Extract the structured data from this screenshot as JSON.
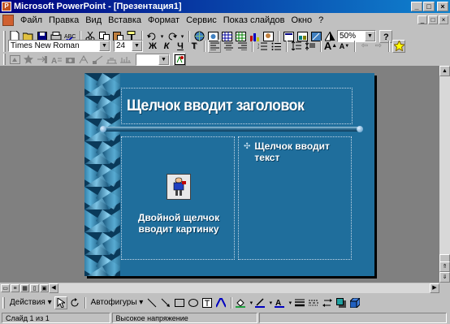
{
  "window": {
    "title": "Microsoft PowerPoint - [Презентация1]",
    "controls": [
      "_",
      "□",
      "×"
    ]
  },
  "menu": {
    "items": [
      "Файл",
      "Правка",
      "Вид",
      "Вставка",
      "Формат",
      "Сервис",
      "Показ слайдов",
      "Окно",
      "?"
    ],
    "doc_controls": [
      "_",
      "□",
      "×"
    ]
  },
  "toolbar_standard": {
    "zoom": "50%",
    "icons": [
      "new-icon",
      "open-icon",
      "save-icon",
      "print-icon",
      "spelling-icon",
      "cut-icon",
      "copy-icon",
      "paste-icon",
      "format-painter-icon",
      "undo-icon",
      "redo-icon",
      "hyperlink-icon",
      "web-toolbar-icon",
      "insert-word-table-icon",
      "insert-excel-icon",
      "insert-chart-icon",
      "new-slide-icon",
      "slide-layout-icon",
      "apply-design-icon",
      "grayscale-icon",
      "help-icon"
    ]
  },
  "toolbar_formatting": {
    "font": "Times New Roman",
    "size": "24",
    "bold": "Ж",
    "italic": "К",
    "underline": "Ч",
    "shadow": "Т"
  },
  "toolbar_effects": {
    "icons": [
      "animation-effects-icon",
      "star-icon",
      "animation-preview-icon",
      "custom-animation-icon",
      "action-settings-icon",
      "slide-transition-icon",
      "hide-slide-icon",
      "rehearse-timings-icon",
      "summary-slide-icon",
      "speaker-notes-icon",
      "effects-icon"
    ]
  },
  "slide": {
    "title": "Щелчок вводит заголовок",
    "clipart_caption": "Двойной щелчок вводит картинку",
    "bullet_text": "Щелчок вводит текст"
  },
  "drawing_toolbar": {
    "actions_label": "Действия",
    "autoshapes_label": "Автофигуры"
  },
  "status": {
    "slide_info": "Слайд 1 из 1",
    "design_name": "Высокое напряжение"
  },
  "colors": {
    "slide_bg": "#1f6e9c",
    "titlebar_start": "#000080",
    "titlebar_end": "#1084d0",
    "workspace": "#808080"
  }
}
